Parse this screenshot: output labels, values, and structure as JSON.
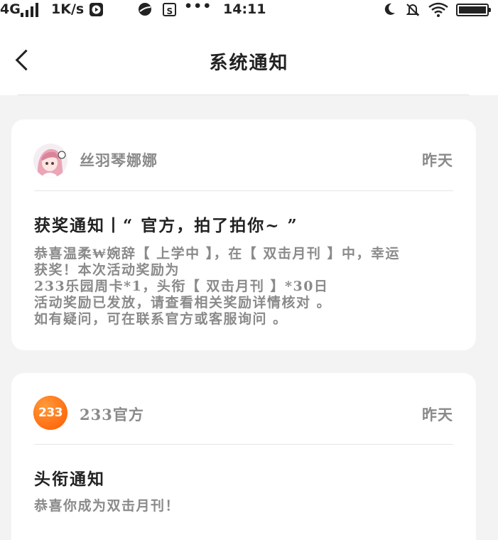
{
  "status_bar": {
    "network": "4G",
    "speed": "1K/s",
    "time": "14:11"
  },
  "header": {
    "title": "系统通知"
  },
  "notifications": [
    {
      "sender": "丝羽琴娜娜",
      "time": "昨天",
      "title": "获奖通知丨“ 官方，拍了拍你~ ”",
      "lines": [
        "恭喜温柔₩婉辞【 上学中 】，在【 双击月刊 】中，幸运",
        "获奖！本次活动奖励为",
        "233乐园周卡*1，头衔【 双击月刊 】*30日",
        "活动奖励已发放，请查看相关奖励详情核对 。",
        "如有疑问，可在联系官方或客服询问 。"
      ]
    },
    {
      "sender": "233官方",
      "avatar_text": "233",
      "time": "昨天",
      "title": "头衔通知",
      "lines": [
        "恭喜你成为双击月刊！"
      ]
    }
  ]
}
